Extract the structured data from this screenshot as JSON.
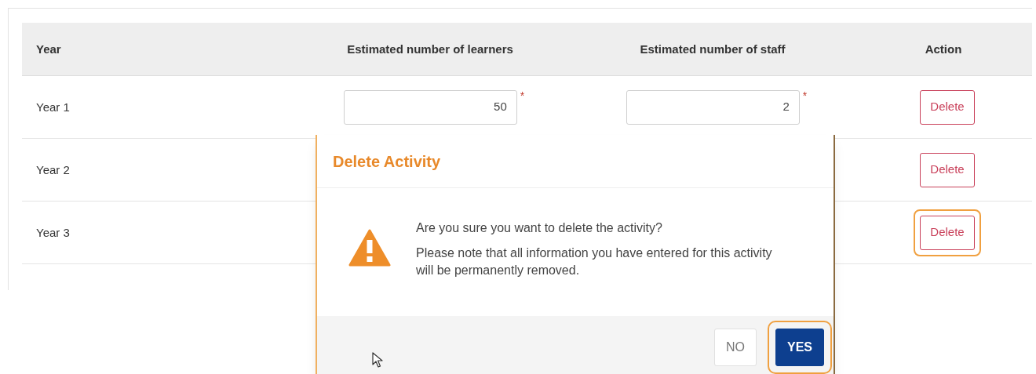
{
  "table": {
    "columns": [
      "Year",
      "Estimated number of learners",
      "Estimated number of staff",
      "Action"
    ],
    "rows": [
      {
        "year": "Year 1",
        "learners": "50",
        "staff": "2",
        "required_mark": "*",
        "action": "Delete",
        "highlighted": false
      },
      {
        "year": "Year 2",
        "action": "Delete",
        "highlighted": false
      },
      {
        "year": "Year 3",
        "action": "Delete",
        "highlighted": true
      }
    ]
  },
  "dialog": {
    "title": "Delete Activity",
    "messages": [
      "Are you sure you want to delete the activity?",
      "Please note that all information you have entered for this activity will be permanently removed."
    ],
    "buttons": [
      {
        "label": "NO",
        "kind": "secondary",
        "highlighted": false
      },
      {
        "label": "YES",
        "kind": "primary",
        "highlighted": true
      }
    ]
  }
}
